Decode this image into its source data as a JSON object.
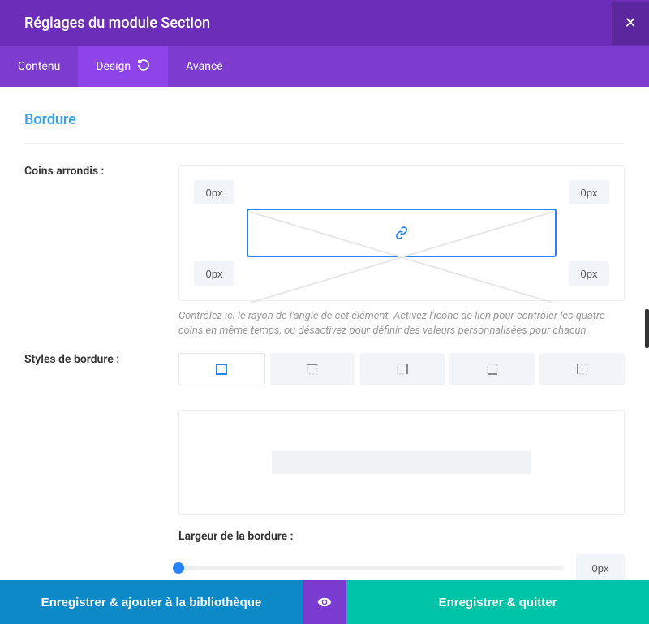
{
  "header": {
    "title": "Réglages du module Section"
  },
  "tabs": {
    "content": "Contenu",
    "design": "Design",
    "advanced": "Avancé",
    "active": "design"
  },
  "section": {
    "title": "Bordure"
  },
  "corners": {
    "label": "Coins arrondis :",
    "tl": "0px",
    "tr": "0px",
    "bl": "0px",
    "br": "0px",
    "help": "Contrôlez ici le rayon de l'angle de cet élément. Activez l'icône de lien pour contrôler les quatre coins en même temps, ou désactivez pour définir des valeurs personnalisées pour chacun."
  },
  "styles": {
    "label": "Styles de bordure :"
  },
  "border_width": {
    "label": "Largeur de la bordure :",
    "value": "0px"
  },
  "footer": {
    "save_library": "Enregistrer & ajouter à la bibliothèque",
    "save_quit": "Enregistrer & quitter"
  }
}
